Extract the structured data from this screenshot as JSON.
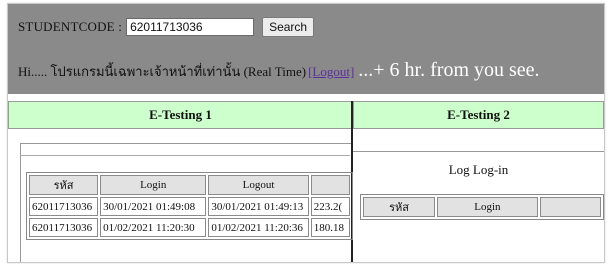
{
  "search": {
    "label": "STUDENTCODE :",
    "value": "62011713036",
    "button_label": "Search"
  },
  "info": {
    "greeting": "Hi..... โปรแกรมนี้เฉพาะเจ้าหน้าที่เท่านั้น (Real Time)",
    "logout_link": "[Logout]",
    "note": "...+ 6 hr. from you see."
  },
  "panel1": {
    "title": "E-Testing 1",
    "columns": [
      "รหัส",
      "Login",
      "Logout",
      ""
    ],
    "rows": [
      [
        "62011713036",
        "30/01/2021 01:49:08",
        "30/01/2021 01:49:13",
        "223.2("
      ],
      [
        "62011713036",
        "01/02/2021 11:20:30",
        "01/02/2021 11:20:36",
        "180.18"
      ]
    ]
  },
  "panel2": {
    "title": "E-Testing 2",
    "log_title": "Log Log-in",
    "columns": [
      "รหัส",
      "Login",
      ""
    ]
  },
  "colors": {
    "topbar": "#8a8a8a",
    "panel_header": "#ccffcc",
    "link": "#5b2f9e"
  }
}
